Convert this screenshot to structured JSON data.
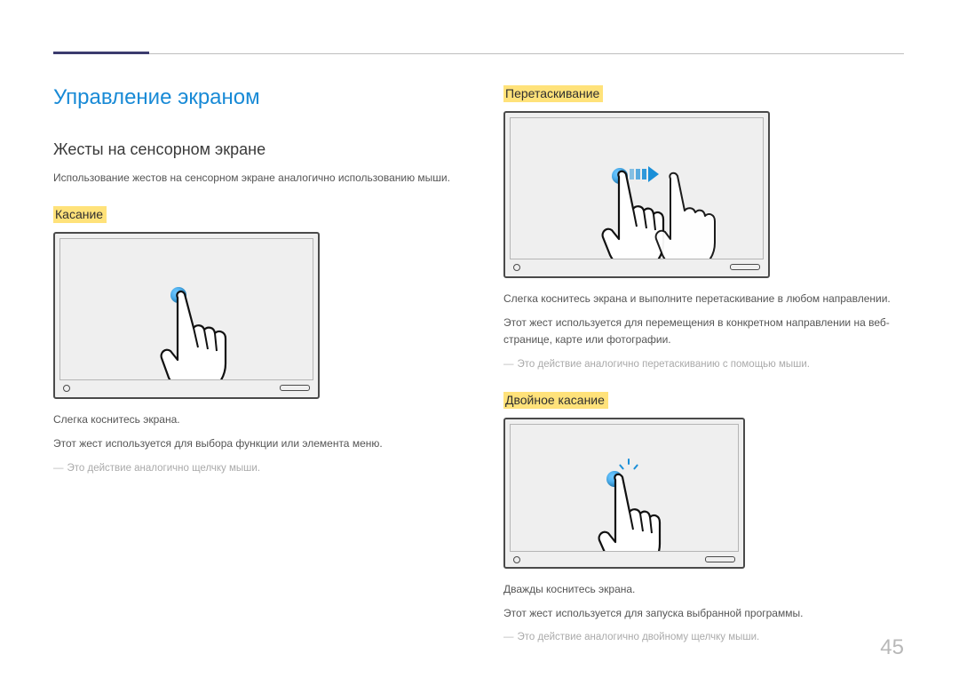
{
  "page_number": "45",
  "title": "Управление экраном",
  "subtitle": "Жесты на сенсорном экране",
  "intro": "Использование жестов на сенсорном экране аналогично использованию мыши.",
  "sections": {
    "touch": {
      "label": "Касание",
      "p1": "Слегка коснитесь экрана.",
      "p2": "Этот жест используется для выбора функции или элемента меню.",
      "note": "Это действие аналогично щелчку мыши."
    },
    "drag": {
      "label": "Перетаскивание",
      "p1": "Слегка коснитесь экрана и выполните перетаскивание в любом направлении.",
      "p2": "Этот жест используется для перемещения в конкретном направлении на веб-странице, карте или фотографии.",
      "note": "Это действие аналогично перетаскиванию с помощью мыши."
    },
    "doubletap": {
      "label": "Двойное касание",
      "p1": "Дважды коснитесь экрана.",
      "p2": "Этот жест используется для запуска выбранной программы.",
      "note": "Это действие аналогично двойному щелчку мыши."
    }
  }
}
